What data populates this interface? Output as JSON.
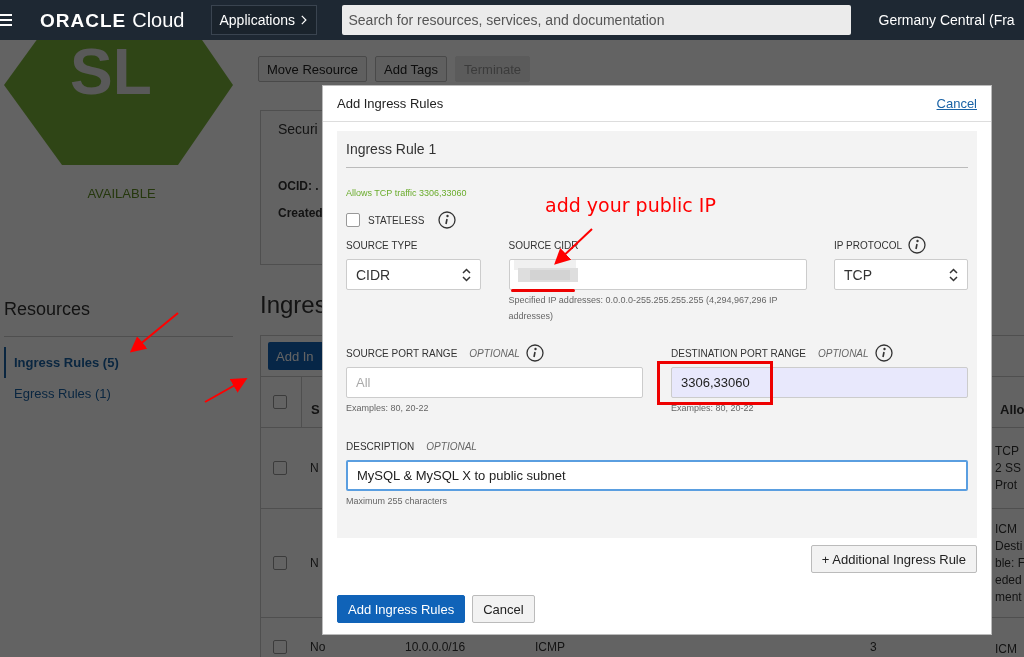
{
  "header": {
    "logo_brand": "ORACLE",
    "logo_product": "Cloud",
    "apps_button": "Applications",
    "search": {
      "placeholder": "Search for resources, services, and documentation"
    },
    "region": "Germany Central (Fra"
  },
  "resource": {
    "initials": "SL",
    "status": "AVAILABLE"
  },
  "actions": [
    {
      "label": "Move Resource",
      "disabled": false
    },
    {
      "label": "Add Tags",
      "disabled": false
    },
    {
      "label": "Terminate",
      "disabled": true
    }
  ],
  "details": {
    "title": "Securi",
    "fields": [
      "OCID: .",
      "Created"
    ]
  },
  "resources": {
    "title": "Resources",
    "items": [
      {
        "label": "Ingress Rules (5)",
        "selected": true
      },
      {
        "label": "Egress Rules (1)",
        "selected": false
      }
    ]
  },
  "section_title": "Ingres",
  "add_button": "Add In",
  "table": {
    "header": {
      "checked": false,
      "stateless": "S",
      "allows": "Allo"
    },
    "rows": [
      {
        "checked": false,
        "stateless": "N",
        "allows": [
          "TCP",
          "2 SS",
          "Prot"
        ]
      },
      {
        "checked": false,
        "stateless": "N",
        "allows": [
          "ICM",
          "Desti",
          "ble: F",
          "eded",
          "ment"
        ]
      },
      {
        "checked": false,
        "stateless": "No",
        "source": "10.0.0.0/16",
        "protocol": "ICMP",
        "port": "3",
        "allows": [
          "ICM"
        ]
      }
    ]
  },
  "dialog": {
    "title": "Add Ingress Rules",
    "cancel_link": "Cancel",
    "rule": {
      "title": "Ingress Rule 1",
      "summary": "Allows TCP traffic 3306,33060",
      "stateless": {
        "label": "STATELESS",
        "checked": false
      },
      "source_type": {
        "label": "SOURCE TYPE",
        "value": "CIDR"
      },
      "source_cidr": {
        "label": "SOURCE CIDR",
        "help": "Specified IP addresses: 0.0.0.0-255.255.255.255 (4,294,967,296 IP addresses)"
      },
      "ip_protocol": {
        "label": "IP PROTOCOL",
        "value": "TCP"
      },
      "source_port": {
        "label": "SOURCE PORT RANGE",
        "optional": "OPTIONAL",
        "placeholder": "All",
        "help": "Examples: 80, 20-22"
      },
      "dest_port": {
        "label": "DESTINATION PORT RANGE",
        "optional": "OPTIONAL",
        "value": "3306,33060",
        "help": "Examples: 80, 20-22"
      },
      "description": {
        "label": "DESCRIPTION",
        "optional": "OPTIONAL",
        "value": "MySQL & MySQL X to public subnet",
        "help": "Maximum 255 characters"
      }
    },
    "additional_button": "+ Additional Ingress Rule",
    "submit_button": "Add Ingress Rules",
    "cancel_button": "Cancel"
  },
  "annotation": {
    "note": "add your public IP"
  }
}
